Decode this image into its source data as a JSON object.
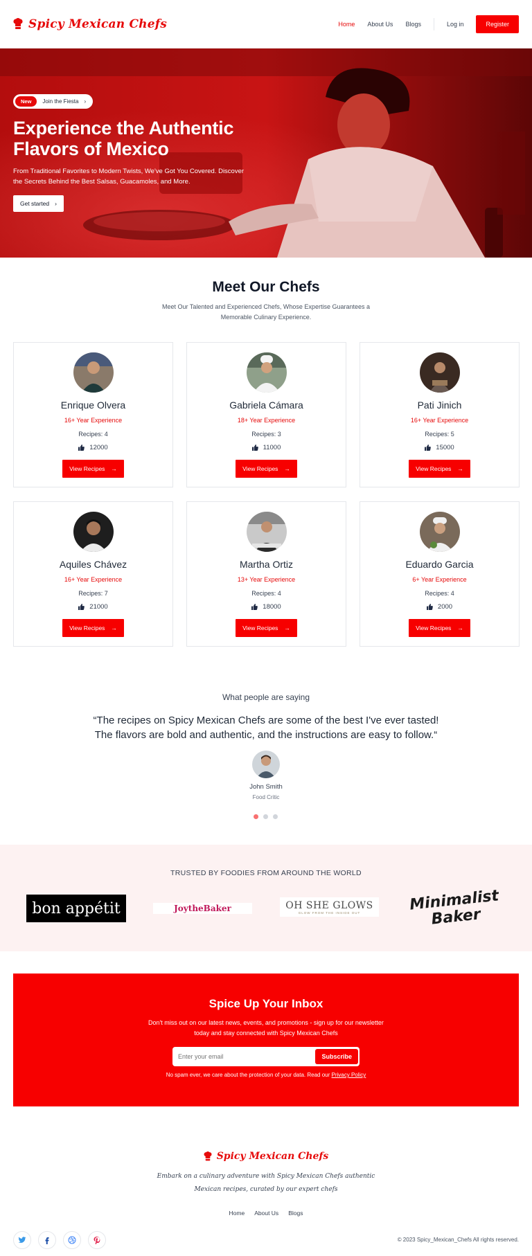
{
  "header": {
    "brand": "Spicy Mexican Chefs",
    "nav": [
      "Home",
      "About Us",
      "Blogs"
    ],
    "login": "Log in",
    "register": "Register"
  },
  "hero": {
    "badge": "New",
    "badge_text": "Join the Fiesta",
    "title_line1": "Experience the Authentic",
    "title_line2": "Flavors of Mexico",
    "subtitle": "From Traditional Favorites to Modern Twists, We've Got You Covered. Discover the Secrets Behind the Best Salsas, Guacamoles, and More.",
    "cta": "Get started"
  },
  "chefs": {
    "title": "Meet Our Chefs",
    "subtitle": "Meet Our Talented and Experienced Chefs, Whose Expertise Guarantees a Memorable Culinary Experience.",
    "button_label": "View Recipes",
    "items": [
      {
        "name": "Enrique Olvera",
        "experience": "16+ Year Experience",
        "recipes": "Recipes: 4",
        "likes": "12000"
      },
      {
        "name": "Gabriela Cámara",
        "experience": "18+ Year Experience",
        "recipes": "Recipes: 3",
        "likes": "11000"
      },
      {
        "name": "Pati Jinich",
        "experience": "16+ Year Experience",
        "recipes": "Recipes: 5",
        "likes": "15000"
      },
      {
        "name": "Aquiles Chávez",
        "experience": "16+ Year Experience",
        "recipes": "Recipes: 7",
        "likes": "21000"
      },
      {
        "name": "Martha Ortiz",
        "experience": "13+ Year Experience",
        "recipes": "Recipes: 4",
        "likes": "18000"
      },
      {
        "name": "Eduardo Garcia",
        "experience": "6+ Year Experience",
        "recipes": "Recipes: 4",
        "likes": "2000"
      }
    ]
  },
  "testimonial": {
    "label": "What people are saying",
    "quote": "“The recipes on Spicy Mexican Chefs are some of the best I've ever tasted! The flavors are bold and authentic, and the instructions are easy to follow.“",
    "name": "John Smith",
    "role": "Food Critic"
  },
  "trusted": {
    "title": "TRUSTED BY FOODIES FROM AROUND THE WORLD",
    "brands": [
      "bon appétit",
      "JoytheBaker",
      "OH SHE GLOWS",
      "GLOW FROM THE INSIDE OUT",
      "Minimalist",
      "Baker"
    ]
  },
  "newsletter": {
    "title": "Spice Up Your Inbox",
    "subtitle": "Don't miss out on our latest news, events, and promotions - sign up for our newsletter today and stay connected with Spicy Mexican Chefs",
    "placeholder": "Enter your email",
    "button": "Subscribe",
    "note": "No spam ever, we care about the protection of your data. Read our",
    "link": "Privacy Policy"
  },
  "footer": {
    "brand": "Spicy Mexican Chefs",
    "tagline": "Embark on a culinary adventure with Spicy Mexican Chefs authentic Mexican recipes, curated by our expert chefs",
    "links": [
      "Home",
      "About Us",
      "Blogs"
    ],
    "copyright": "© 2023 Spicy_Mexican_Chefs All rights reserved."
  },
  "colors": {
    "accent": "#f70000",
    "brand_red": "#e60a0a",
    "trusted_bg": "#fdf2f2"
  },
  "icons": [
    "chef-hat-icon",
    "chevron-right-icon",
    "thumbs-up-icon",
    "arrow-right-icon",
    "twitter-icon",
    "facebook-icon",
    "dribbble-icon",
    "pinterest-icon"
  ]
}
